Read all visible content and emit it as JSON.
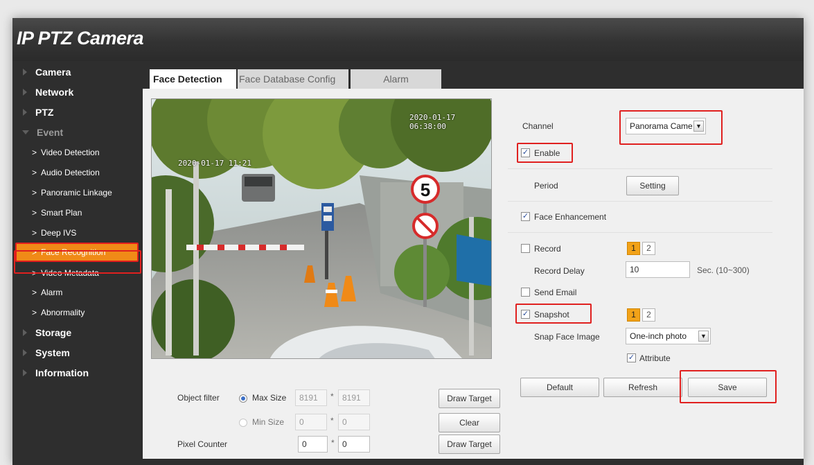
{
  "app": {
    "title": "IP PTZ Camera"
  },
  "sidebar": {
    "items": [
      {
        "label": "Camera"
      },
      {
        "label": "Network"
      },
      {
        "label": "PTZ"
      },
      {
        "label": "Event"
      },
      {
        "label": "Storage"
      },
      {
        "label": "System"
      },
      {
        "label": "Information"
      }
    ],
    "event_subitems": [
      {
        "label": "Video Detection"
      },
      {
        "label": "Audio Detection"
      },
      {
        "label": "Panoramic Linkage"
      },
      {
        "label": "Smart Plan"
      },
      {
        "label": "Deep IVS"
      },
      {
        "label": "Face Recognition"
      },
      {
        "label": "Video Metadata"
      },
      {
        "label": "Alarm"
      },
      {
        "label": "Abnormality"
      }
    ]
  },
  "tabs": [
    {
      "label": "Face Detection"
    },
    {
      "label": "Face Database Config"
    },
    {
      "label": "Alarm"
    }
  ],
  "video": {
    "osd_timestamp": "2020-01-17 06:38:00",
    "osd_left": "2020-01-17 11:21"
  },
  "filters": {
    "object_filter_label": "Object filter",
    "max_size_label": "Max Size",
    "max_w": "8191",
    "max_h": "8191",
    "min_size_label": "Min Size",
    "min_w": "0",
    "min_h": "0",
    "separator": "*",
    "pixel_counter_label": "Pixel Counter",
    "pixel_w": "0",
    "pixel_h": "0",
    "draw_target_label": "Draw Target",
    "clear_label": "Clear"
  },
  "settings": {
    "channel_label": "Channel",
    "channel_value": "Panorama Came",
    "enable_label": "Enable",
    "period_label": "Period",
    "setting_button": "Setting",
    "face_enhancement_label": "Face Enhancement",
    "record_label": "Record",
    "record_delay_label": "Record Delay",
    "record_delay_value": "10",
    "record_delay_unit": "Sec. (10~300)",
    "send_email_label": "Send Email",
    "snapshot_label": "Snapshot",
    "snap_face_image_label": "Snap Face Image",
    "snap_face_image_value": "One-inch photo",
    "attribute_label": "Attribute",
    "schedule_1": "1",
    "schedule_2": "2"
  },
  "actions": {
    "default_label": "Default",
    "refresh_label": "Refresh",
    "save_label": "Save"
  },
  "colors": {
    "highlight_red": "#e0201f",
    "active_orange": "#f08a17"
  }
}
